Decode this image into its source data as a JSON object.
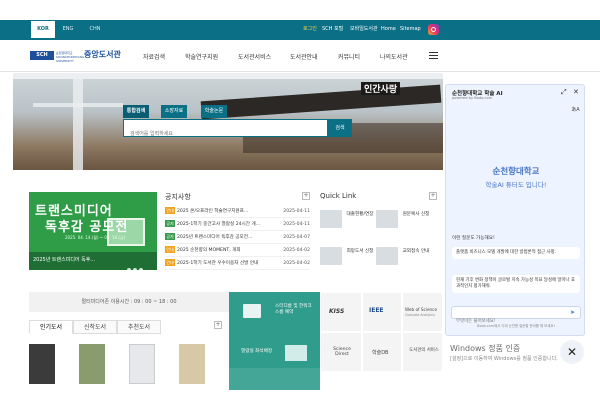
{
  "topbar": {
    "langs": [
      "KOR",
      "ENG",
      "CHN"
    ],
    "links": [
      "로그인",
      "SCH 포털",
      "모바일도서관",
      "Home",
      "Sitemap"
    ]
  },
  "header": {
    "logo_badge": "SCH",
    "logo_small": "순천향대학교 SOONCHUNHYANG UNIVERSITY",
    "logo_text": "중앙도서관",
    "nav": [
      "자료검색",
      "학술연구지원",
      "도서관서비스",
      "도서관안내",
      "커뮤니티",
      "나의도서관"
    ]
  },
  "hero": {
    "sign": "인간사랑",
    "tabs": [
      "통합검색",
      "소장자료",
      "학술논문"
    ],
    "placeholder": "검색어를 입력하세요",
    "search_label": "검색"
  },
  "banner": {
    "line1": "트랜스미디어",
    "line2": "독후감 공모전",
    "date": "2025. 04. 14.(월) ~ 05. 16.(금)",
    "caption": "2025년 트랜스미디어 독후..."
  },
  "notices": {
    "title": "공지사항",
    "items": [
      {
        "tag": "안내",
        "text": "2025 온/오프라인 학술연구지원프…",
        "date": "2025-04-11"
      },
      {
        "tag": "공지",
        "text": "2025-1학기 중간고사 열람실 24시간 개…",
        "date": "2025-04-11"
      },
      {
        "tag": "공지",
        "text": "2025년 트랜스미디어 독후감 공모전…",
        "date": "2025-04-07"
      },
      {
        "tag": "안내",
        "text": "2025 순천향의 MOMENT, 개최",
        "date": "2025-04-02"
      },
      {
        "tag": "안내",
        "text": "2025-1학기 도서관 우수이용자 선발 안내",
        "date": "2025-04-02"
      }
    ]
  },
  "quicklink": {
    "title": "Quick Link",
    "items": [
      "대출현황/연장",
      "원문복사 신청",
      "희망도서 신청",
      "교외접속 안내"
    ]
  },
  "hours": "멀티미디어존 이용시간 : 09 : 00 ~ 18 : 00",
  "booktabs": [
    "인기도서",
    "신착도서",
    "추천도서"
  ],
  "services": {
    "tutorial": "스터디룸 및 한워크스룸 예약",
    "seat": "열람실 좌석배정",
    "kiss": "KISS",
    "ieee": "IEEE",
    "wos": "Web of Science",
    "wos_sub": "Clarivate Analytics",
    "sd": "Science Direct",
    "db": "학술DB",
    "lib": "도서관의 서비스"
  },
  "ai": {
    "title": "순천향대학교 학술 AI",
    "powered": "powered by Bodo.com",
    "h1": "순천향대학교",
    "h2": "학술AI 튜터도 입니다!",
    "q": "이런 질문도 가능해요!",
    "cards": [
      "플랫폼 비즈니스 모델 개발에 대한 방법론적 접근 사항.",
      "현재 기후 변화 정책이 글로벌 지속 가능성 목표 달성에 얼마나 효과적인지 평가해줘."
    ],
    "placeholder": "무엇이든 물어보세요!",
    "footer": "Bodo.com에서 이제 순천향 질문할 준비를 해 보세요!"
  },
  "windows": {
    "line1": "Windows 정품 인증",
    "line2": "[설정]으로 이동하여 Windows를 정품 인증합니다."
  },
  "colors": {
    "teal": "#0b6f86",
    "brand": "#1d4f9a",
    "green": "#2f9c47"
  }
}
